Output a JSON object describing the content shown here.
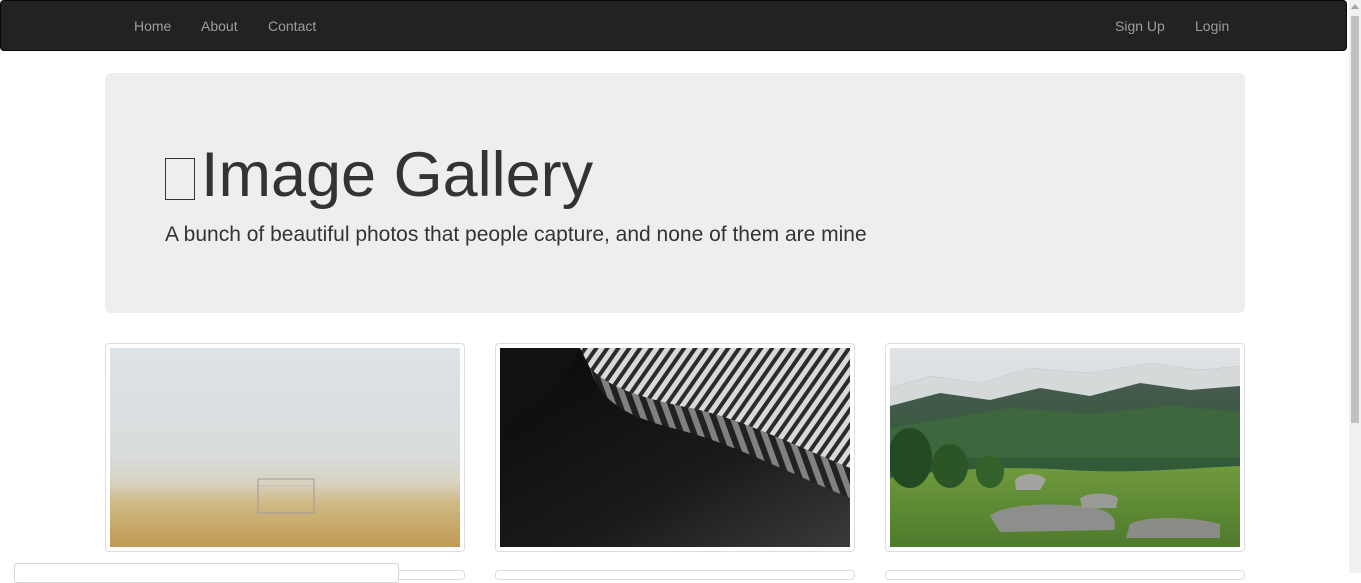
{
  "nav": {
    "left_items": [
      "Home",
      "About",
      "Contact"
    ],
    "right_items": [
      "Sign Up",
      "Login"
    ]
  },
  "jumbotron": {
    "title_icon": "picture-icon",
    "title": "Image Gallery",
    "subtitle": "A bunch of beautiful photos that people capture, and none of them are mine"
  },
  "gallery": {
    "thumbnails": [
      {
        "subject": "foggy-field-with-goal"
      },
      {
        "subject": "abstract-architecture-waves"
      },
      {
        "subject": "mountain-valley-landscape"
      }
    ]
  }
}
